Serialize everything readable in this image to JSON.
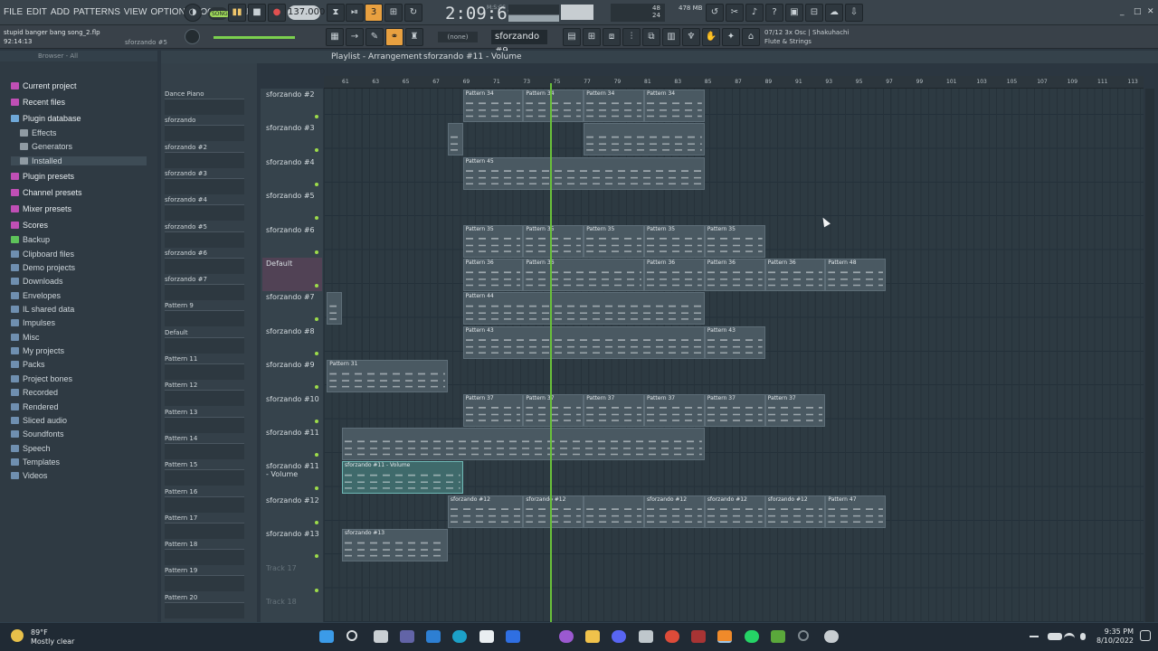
{
  "menu": {
    "items": [
      "FILE",
      "EDIT",
      "ADD",
      "PATTERNS",
      "VIEW",
      "OPTIONS",
      "TOOLS",
      "HELP"
    ],
    "song_label": "SONG",
    "tempo": "137.000",
    "time": "2:09:69",
    "mcs": "M:S:CS",
    "cpu_mb": "478 MB",
    "cpu_num": "48",
    "cpu_num2": "24"
  },
  "project": {
    "name": "stupid banger bang song_2.flp",
    "time": "92:14:13",
    "channel": "sforzando #5"
  },
  "toolbar": {
    "none_label": "(none)",
    "pattern": "sforzando #9",
    "hint_line1": "07/12  3x Osc | Shakuhachi",
    "hint_line2": "Flute & Strings"
  },
  "browser": {
    "header": "Browser - All",
    "items": [
      {
        "label": "Current project",
        "color": "#c04fb5"
      },
      {
        "label": "Recent files",
        "color": "#c04fb5"
      },
      {
        "label": "Plugin database",
        "color": "#6fa8d8"
      },
      {
        "label": "Effects",
        "color": "#8f9aa2",
        "indent": true
      },
      {
        "label": "Generators",
        "color": "#8f9aa2",
        "indent": true
      },
      {
        "label": "Installed",
        "color": "#8f9aa2",
        "indent": true
      },
      {
        "label": "Plugin presets",
        "color": "#c04fb5"
      },
      {
        "label": "Channel presets",
        "color": "#c04fb5"
      },
      {
        "label": "Mixer presets",
        "color": "#c04fb5"
      },
      {
        "label": "Scores",
        "color": "#c04fb5"
      },
      {
        "label": "Backup",
        "color": "#5ec35a"
      },
      {
        "label": "Clipboard files",
        "color": "#6f8fb0"
      },
      {
        "label": "Demo projects",
        "color": "#6f8fb0"
      },
      {
        "label": "Downloads",
        "color": "#6f8fb0"
      },
      {
        "label": "Envelopes",
        "color": "#6f8fb0"
      },
      {
        "label": "IL shared data",
        "color": "#6f8fb0"
      },
      {
        "label": "Impulses",
        "color": "#6f8fb0"
      },
      {
        "label": "Misc",
        "color": "#6f8fb0"
      },
      {
        "label": "My projects",
        "color": "#6f8fb0"
      },
      {
        "label": "Packs",
        "color": "#6f8fb0"
      },
      {
        "label": "Project bones",
        "color": "#6f8fb0"
      },
      {
        "label": "Recorded",
        "color": "#6f8fb0"
      },
      {
        "label": "Rendered",
        "color": "#6f8fb0"
      },
      {
        "label": "Sliced audio",
        "color": "#6f8fb0"
      },
      {
        "label": "Soundfonts",
        "color": "#6f8fb0"
      },
      {
        "label": "Speech",
        "color": "#6f8fb0"
      },
      {
        "label": "Templates",
        "color": "#6f8fb0"
      },
      {
        "label": "Videos",
        "color": "#6f8fb0"
      }
    ]
  },
  "playlist": {
    "title": "Playlist - Arrangement",
    "crumb": "sforzando #11 - Volume"
  },
  "channels": [
    "Dance Piano",
    "sforzando",
    "sforzando #2",
    "sforzando #3",
    "sforzando #4",
    "sforzando #5",
    "sforzando #6",
    "sforzando #7",
    "Pattern 9",
    "Default",
    "Pattern 11",
    "Pattern 12",
    "Pattern 13",
    "Pattern 14",
    "Pattern 15",
    "Pattern 16",
    "Pattern 17",
    "Pattern 18",
    "Pattern 19",
    "Pattern 20"
  ],
  "tracks": [
    "sforzando #2",
    "sforzando #3",
    "sforzando #4",
    "sforzando #5",
    "sforzando #6",
    "Default",
    "sforzando #7",
    "sforzando #8",
    "sforzando #9",
    "sforzando #10",
    "sforzando #11",
    "sforzando #11 - Volume",
    "sforzando #12",
    "sforzando #13",
    "Track 17",
    "Track 18"
  ],
  "ruler": [
    "61",
    "63",
    "65",
    "67",
    "69",
    "71",
    "73",
    "75",
    "77",
    "79",
    "81",
    "83",
    "85",
    "87",
    "89",
    "91",
    "93",
    "95",
    "97",
    "99",
    "101",
    "103",
    "105",
    "107",
    "109",
    "111",
    "113"
  ],
  "clips": [
    {
      "row": 0,
      "start": 69,
      "end": 73,
      "label": "Pattern 34"
    },
    {
      "row": 0,
      "start": 73,
      "end": 77,
      "label": "Pattern 34"
    },
    {
      "row": 0,
      "start": 77,
      "end": 81,
      "label": "Pattern 34"
    },
    {
      "row": 0,
      "start": 81,
      "end": 85,
      "label": "Pattern 34"
    },
    {
      "row": 1,
      "start": 68,
      "end": 69,
      "label": ""
    },
    {
      "row": 1,
      "start": 77,
      "end": 85,
      "label": ""
    },
    {
      "row": 2,
      "start": 69,
      "end": 85,
      "label": "Pattern 45"
    },
    {
      "row": 4,
      "start": 69,
      "end": 73,
      "label": "Pattern 35"
    },
    {
      "row": 4,
      "start": 73,
      "end": 77,
      "label": "Pattern 35"
    },
    {
      "row": 4,
      "start": 77,
      "end": 81,
      "label": "Pattern 35"
    },
    {
      "row": 4,
      "start": 81,
      "end": 85,
      "label": "Pattern 35"
    },
    {
      "row": 4,
      "start": 85,
      "end": 89,
      "label": "Pattern 35"
    },
    {
      "row": 5,
      "start": 69,
      "end": 73,
      "label": "Pattern 36"
    },
    {
      "row": 5,
      "start": 73,
      "end": 81,
      "label": "Pattern 36"
    },
    {
      "row": 5,
      "start": 81,
      "end": 85,
      "label": "Pattern 36"
    },
    {
      "row": 5,
      "start": 85,
      "end": 89,
      "label": "Pattern 36"
    },
    {
      "row": 5,
      "start": 89,
      "end": 93,
      "label": "Pattern 36"
    },
    {
      "row": 5,
      "start": 93,
      "end": 97,
      "label": "Pattern 48"
    },
    {
      "row": 6,
      "start": 60,
      "end": 61,
      "label": ""
    },
    {
      "row": 6,
      "start": 69,
      "end": 85,
      "label": "Pattern 44"
    },
    {
      "row": 7,
      "start": 69,
      "end": 85,
      "label": "Pattern 43"
    },
    {
      "row": 7,
      "start": 85,
      "end": 89,
      "label": "Pattern 43"
    },
    {
      "row": 8,
      "start": 60,
      "end": 68,
      "label": "Pattern 31"
    },
    {
      "row": 9,
      "start": 69,
      "end": 73,
      "label": "Pattern 37"
    },
    {
      "row": 9,
      "start": 73,
      "end": 77,
      "label": "Pattern 37"
    },
    {
      "row": 9,
      "start": 77,
      "end": 81,
      "label": "Pattern 37"
    },
    {
      "row": 9,
      "start": 81,
      "end": 85,
      "label": "Pattern 37"
    },
    {
      "row": 9,
      "start": 85,
      "end": 89,
      "label": "Pattern 37"
    },
    {
      "row": 9,
      "start": 89,
      "end": 93,
      "label": "Pattern 37"
    },
    {
      "row": 10,
      "start": 61,
      "end": 85,
      "label": ""
    },
    {
      "row": 11,
      "start": 61,
      "end": 69,
      "label": "sforzando #11 - Volume"
    },
    {
      "row": 12,
      "start": 68,
      "end": 73,
      "label": "sforzando #12"
    },
    {
      "row": 12,
      "start": 73,
      "end": 77,
      "label": "sforzando #12"
    },
    {
      "row": 12,
      "start": 77,
      "end": 81,
      "label": ""
    },
    {
      "row": 12,
      "start": 81,
      "end": 85,
      "label": "sforzando #12"
    },
    {
      "row": 12,
      "start": 85,
      "end": 89,
      "label": "sforzando #12"
    },
    {
      "row": 12,
      "start": 89,
      "end": 93,
      "label": "sforzando #12"
    },
    {
      "row": 12,
      "start": 93,
      "end": 97,
      "label": "Pattern 47"
    },
    {
      "row": 13,
      "start": 61,
      "end": 68,
      "label": "sforzando #13"
    }
  ],
  "taskbar": {
    "temp": "89°F",
    "weather": "Mostly clear",
    "time": "9:35 PM",
    "date": "8/10/2022"
  }
}
